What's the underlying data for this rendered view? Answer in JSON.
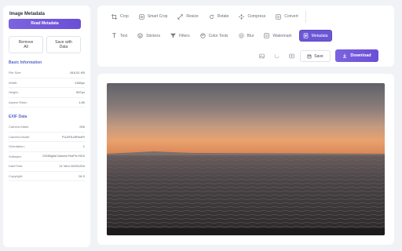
{
  "sidebar": {
    "title": "Image Metadata",
    "read_button": "Read Metadata",
    "remove_all": "Remove All",
    "save_with_data": "Save with Data",
    "basic_info": {
      "heading": "Basic Information",
      "rows": [
        {
          "label": "File Size:",
          "value": "816.51 KB"
        },
        {
          "label": "Width:",
          "value": "1184px"
        },
        {
          "label": "Height:",
          "value": "657px"
        },
        {
          "label": "Aspect Ratio:",
          "value": "1.80"
        }
      ]
    },
    "exif": {
      "heading": "EXIF Data",
      "rows": [
        {
          "label": "Camera Make:",
          "value": "000"
        },
        {
          "label": "Camera Model:",
          "value": "FUJIFILMFinePi"
        },
        {
          "label": "Orientation:",
          "value": "1"
        },
        {
          "label": "Software:",
          "value": "DIGIDigital Camera FinePix H510"
        },
        {
          "label": "DateTime:",
          "value": "11 Ver1.04231204"
        },
        {
          "label": "Copyright:",
          "value": "04 0"
        }
      ]
    }
  },
  "toolbar": {
    "row1": [
      {
        "label": "Crop",
        "icon": "crop-icon"
      },
      {
        "label": "Smart Crop",
        "icon": "smart-crop-icon"
      },
      {
        "label": "Resize",
        "icon": "resize-icon"
      },
      {
        "label": "Rotate",
        "icon": "rotate-icon"
      },
      {
        "label": "Compress",
        "icon": "compress-icon"
      },
      {
        "label": "Convert",
        "icon": "convert-icon"
      }
    ],
    "row2": [
      {
        "label": "Text",
        "icon": "text-icon"
      },
      {
        "label": "Stickers",
        "icon": "stickers-icon"
      },
      {
        "label": "Filters",
        "icon": "filters-icon"
      },
      {
        "label": "Color Tools",
        "icon": "palette-icon"
      },
      {
        "label": "Blur",
        "icon": "blur-icon"
      },
      {
        "label": "Watermark",
        "icon": "watermark-icon"
      },
      {
        "label": "Metadata",
        "icon": "metadata-icon",
        "active": true
      }
    ],
    "save_label": "Save",
    "download_label": "Download"
  },
  "colors": {
    "accent": "#6b57d6",
    "section_heading": "#5a68c8"
  }
}
